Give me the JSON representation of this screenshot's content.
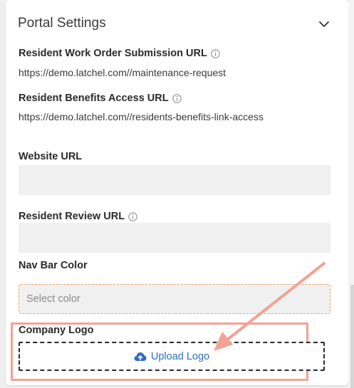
{
  "panel": {
    "title": "Portal Settings"
  },
  "fields": {
    "work_order": {
      "label": "Resident Work Order Submission URL",
      "value": "https://demo.latchel.com//maintenance-request"
    },
    "benefits": {
      "label": "Resident Benefits Access URL",
      "value": "https://demo.latchel.com//residents-benefits-link-access"
    },
    "website": {
      "label": "Website URL",
      "value": ""
    },
    "review": {
      "label": "Resident Review URL",
      "value": ""
    },
    "nav_color": {
      "label": "Nav Bar Color",
      "placeholder": "Select color"
    },
    "logo": {
      "label": "Company Logo",
      "button_label": "Upload Logo"
    }
  },
  "colors": {
    "accent_blue": "#2f6fbd",
    "annotation_salmon": "#f3a293",
    "select_border": "#e7a56d"
  },
  "icons": {
    "collapse": "chevron-down-icon",
    "info": "info-icon",
    "upload": "cloud-upload-icon"
  }
}
